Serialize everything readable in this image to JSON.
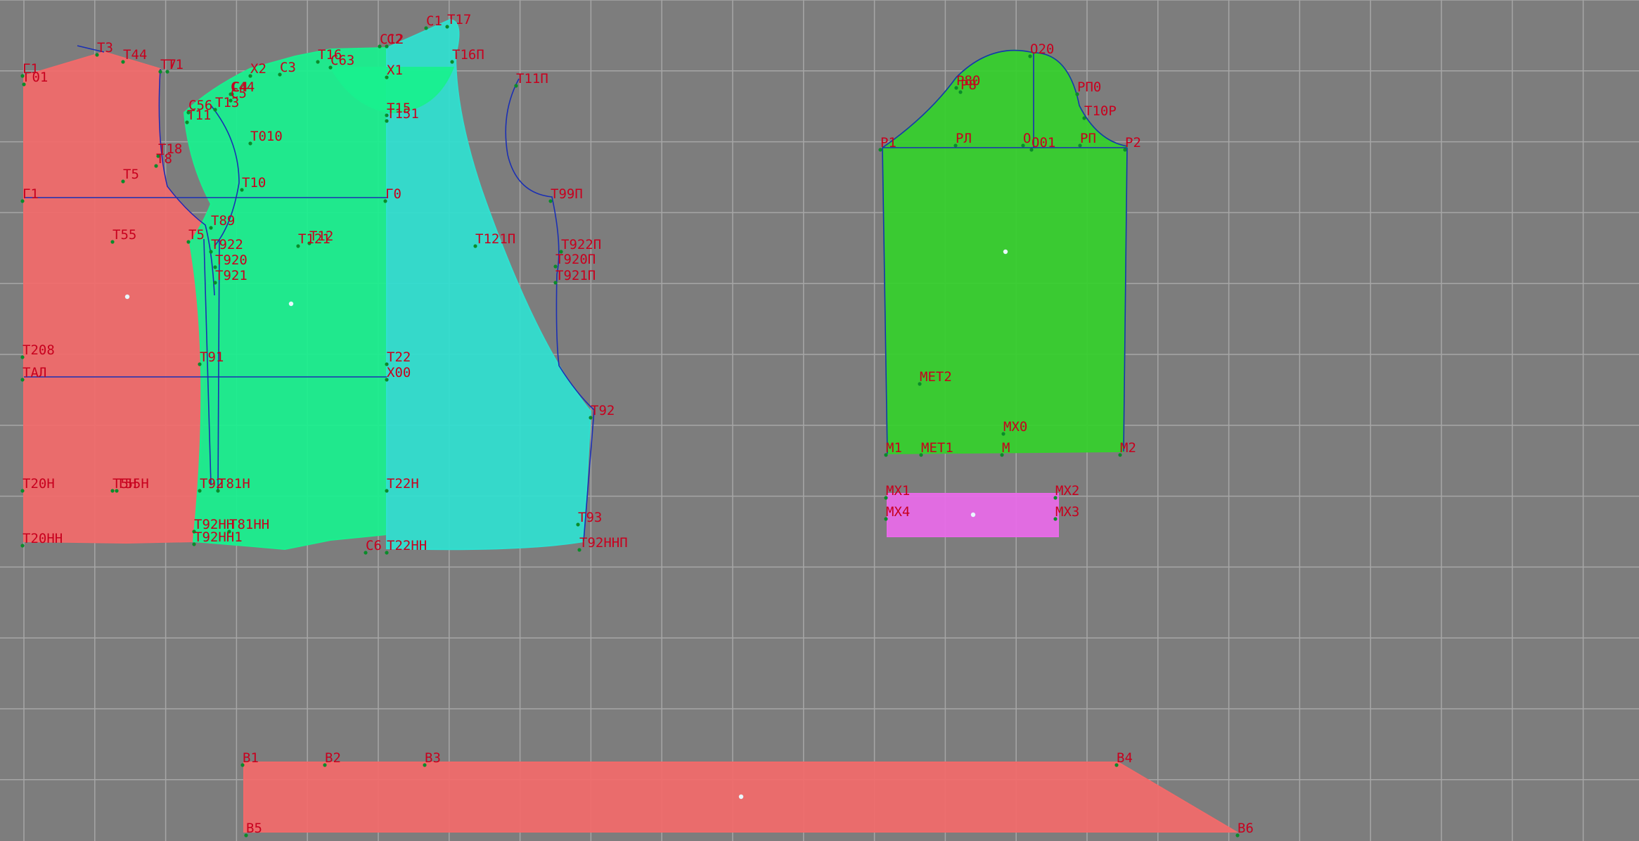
{
  "diagram": {
    "background": "#7d7d7d",
    "grid_color": "#a6a6a6",
    "label_color": "#c8001e",
    "outline_color": "#1a2fb4",
    "point_color": "#0a8c2a",
    "center_mark_color": "#e8f8ff",
    "fills": {
      "back": "#f26a6a",
      "side_panel": "#19f08e",
      "front": "#2fe0d0",
      "sleeve": "#35d02c",
      "cuff": "#e86ae8",
      "belt": "#f26a6a"
    },
    "labels": {
      "bodice": [
        "Г1",
        "Г01",
        "Т3",
        "Т44",
        "Т7",
        "Т1",
        "Х2",
        "С3",
        "С4",
        "С44",
        "С5",
        "С56",
        "Т13",
        "Т11",
        "Т16",
        "С63",
        "С12",
        "С2",
        "С1",
        "Т17",
        "Т16П",
        "Х1",
        "Т15",
        "Т151",
        "Т010",
        "Т18",
        "Т8",
        "Т5",
        "Г1",
        "Т10",
        "Г0",
        "Т11П",
        "Т99П",
        "Т55",
        "Т5",
        "Т89",
        "Т922",
        "Т920",
        "Т921",
        "Т121",
        "Т12",
        "Т121П",
        "Т922П",
        "Т920П",
        "Т921П",
        "Т208",
        "Т91",
        "Т22",
        "ТАЛ",
        "Х00",
        "Т92",
        "Т20Н",
        "Т5Н",
        "Т55Н",
        "Т92",
        "Т81Н",
        "Т22Н",
        "Т93",
        "Т92НН",
        "Т81НН",
        "Т20НН",
        "Т92НН1",
        "С6",
        "Т22НН",
        "Т92ННП"
      ],
      "sleeve": [
        "О20",
        "Р80",
        "Р8",
        "РП0",
        "Т10Р",
        "Р1",
        "РЛ",
        "О",
        "О01",
        "РП",
        "Р2",
        "МЕТ2",
        "МХ0",
        "М1",
        "МЕТ1",
        "М",
        "М2"
      ],
      "cuff": [
        "МХ1",
        "МХ2",
        "МХ4",
        "МХ3"
      ],
      "belt": [
        "В1",
        "В2",
        "В3",
        "В4",
        "В5",
        "В6"
      ]
    }
  }
}
